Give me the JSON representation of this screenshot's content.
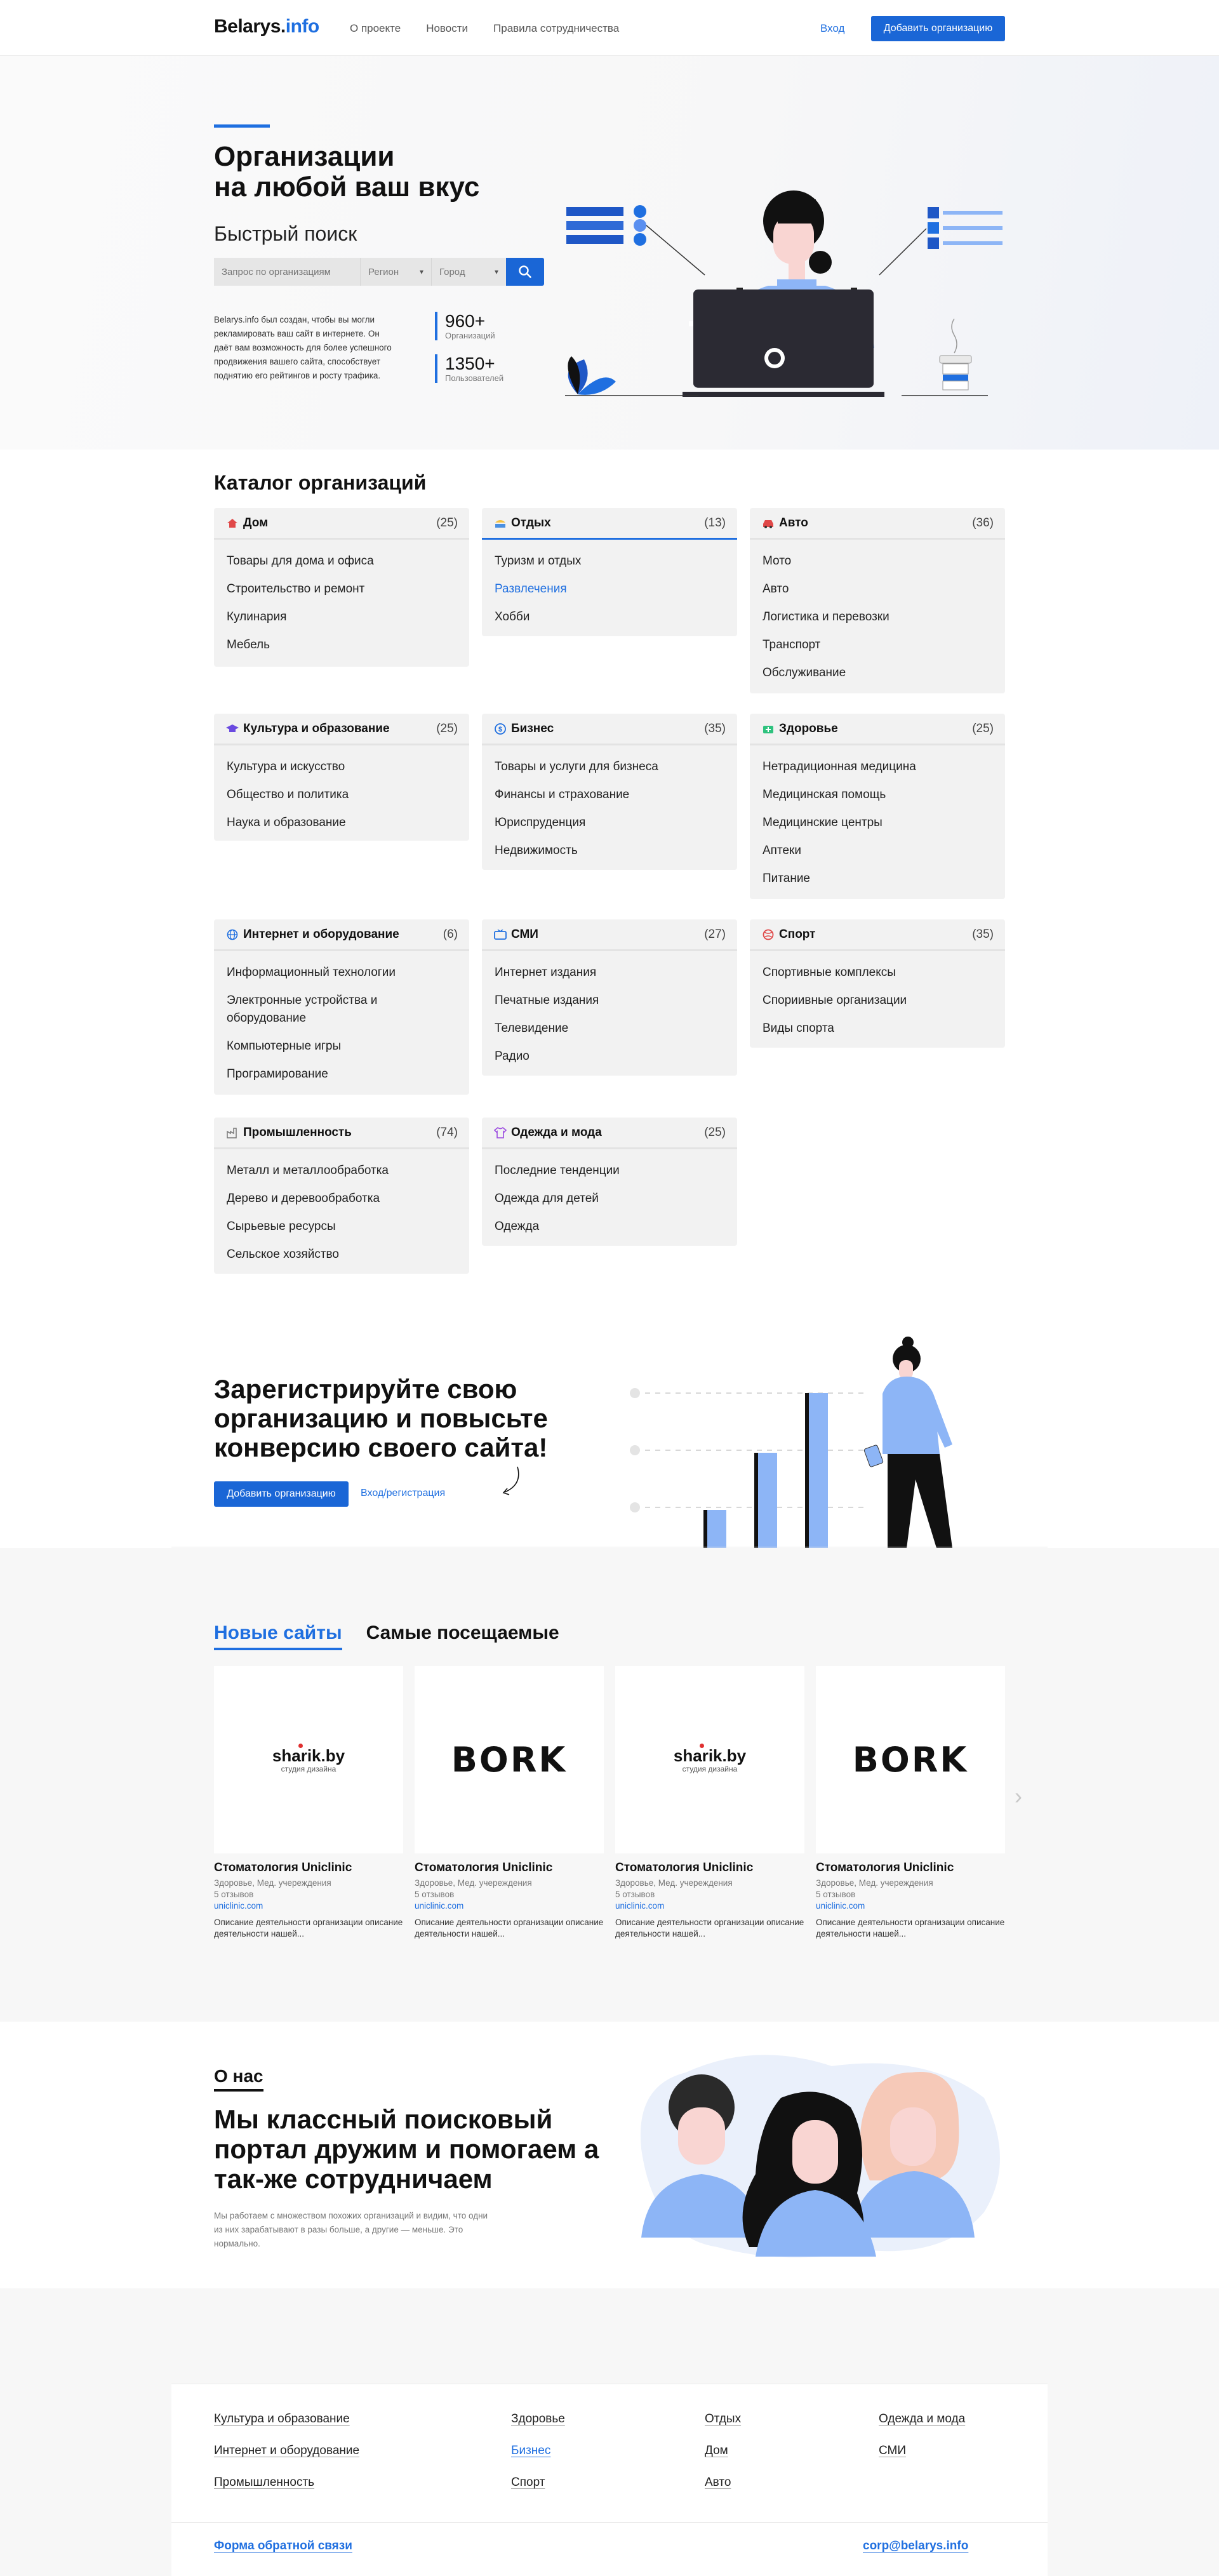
{
  "header": {
    "logo_main": "Belarys.",
    "logo_accent": "info",
    "nav": [
      "О проекте",
      "Новости",
      "Правила сотрудничества"
    ],
    "login": "Вход",
    "add_org": "Добавить организацию"
  },
  "hero": {
    "title_line1": "Организации",
    "title_line2": "на любой ваш вкус",
    "quick_search": "Быстрый поиск",
    "search_placeholder": "Запрос по организациям",
    "region": "Регион",
    "city": "Город",
    "description": "Belarys.info был создан, чтобы вы могли рекламировать ваш сайт в интернете. Он даёт вам возможность для более успешного продвижения вашего сайта, способствует поднятию его рейтингов и росту трафика.",
    "stats": [
      {
        "value": "960+",
        "label": "Организаций"
      },
      {
        "value": "1350+",
        "label": "Пользователей"
      }
    ]
  },
  "catalog": {
    "title": "Каталог организаций",
    "categories": [
      {
        "title": "Дом",
        "count": "(25)",
        "icon": "house-icon",
        "items": [
          "Товары для дома и офиса",
          "Строительство и ремонт",
          "Кулинария",
          "Мебель"
        ]
      },
      {
        "title": "Отдых",
        "count": "(13)",
        "icon": "beach-icon",
        "items": [
          "Туризм и отдых",
          "Развлечения",
          "Хобби"
        ]
      },
      {
        "title": "Авто",
        "count": "(36)",
        "icon": "car-icon",
        "items": [
          "Мото",
          "Авто",
          "Логистика и перевозки",
          "Транспорт",
          "Обслуживание"
        ]
      },
      {
        "title": "Культура и образование",
        "count": "(25)",
        "icon": "graduation-cap-icon",
        "items": [
          "Культура и искусство",
          "Общество и политика",
          "Наука и образование"
        ]
      },
      {
        "title": "Бизнес",
        "count": "(35)",
        "icon": "dollar-icon",
        "items": [
          "Товары и услуги для бизнеса",
          "Финансы и страхование",
          "Юриспруденция",
          "Недвижимость"
        ]
      },
      {
        "title": "Здоровье",
        "count": "(25)",
        "icon": "medical-kit-icon",
        "items": [
          "Нетрадиционная медицина",
          "Медицинская помощь",
          "Медицинские центры",
          "Аптеки",
          "Питание"
        ]
      },
      {
        "title": "Интернет и оборудование",
        "count": "(6)",
        "icon": "globe-icon",
        "items": [
          "Информационный технологии",
          "Электронные устройства и оборудование",
          "Компьютерные игры",
          "Програмирование"
        ]
      },
      {
        "title": "СМИ",
        "count": "(27)",
        "icon": "tv-icon",
        "items": [
          "Интернет издания",
          "Печатные издания",
          "Телевидение",
          "Радио"
        ]
      },
      {
        "title": "Спорт",
        "count": "(35)",
        "icon": "ball-icon",
        "items": [
          "Спортивные комплексы",
          "Спориивные организации",
          "Виды спорта"
        ]
      },
      {
        "title": "Промышленность",
        "count": "(74)",
        "icon": "factory-icon",
        "items": [
          "Металл и металлообработка",
          "Дерево и деревообработка",
          "Сырьевые ресурсы",
          "Сельское хозяйство"
        ]
      },
      {
        "title": "Одежда и мода",
        "count": "(25)",
        "icon": "tshirt-icon",
        "items": [
          "Последние тенденции",
          "Одежда для детей",
          "Одежда"
        ]
      }
    ]
  },
  "register": {
    "title": "Зарегистрируйте свою организацию и повысьте конверсию своего сайта!",
    "add_btn": "Добавить организацию",
    "login_link": "Вход/регистрация"
  },
  "sites": {
    "tab_new": "Новые сайты",
    "tab_popular": "Самые посещаемые",
    "cards": [
      {
        "logo": "sharik",
        "logo_text": "sharik.by",
        "logo_sub": "студия дизайна",
        "name": "Стоматология Uniclinic",
        "tags": "Здоровье, Мед. учереждения",
        "reviews": "5 отзывов",
        "url": "uniclinic.com",
        "text": "Описание деятельности организации описание деятельности нашей..."
      },
      {
        "logo": "bork",
        "logo_text": "BORK",
        "logo_sub": "",
        "name": "Стоматология Uniclinic",
        "tags": "Здоровье, Мед. учереждения",
        "reviews": "5 отзывов",
        "url": "uniclinic.com",
        "text": "Описание деятельности организации описание деятельности нашей..."
      },
      {
        "logo": "sharik",
        "logo_text": "sharik.by",
        "logo_sub": "студия дизайна",
        "name": "Стоматология Uniclinic",
        "tags": "Здоровье, Мед. учереждения",
        "reviews": "5 отзывов",
        "url": "uniclinic.com",
        "text": "Описание деятельности организации описание деятельности нашей..."
      },
      {
        "logo": "bork",
        "logo_text": "BORK",
        "logo_sub": "",
        "name": "Стоматология Uniclinic",
        "tags": "Здоровье, Мед. учереждения",
        "reviews": "5 отзывов",
        "url": "uniclinic.com",
        "text": "Описание деятельности организации описание деятельности нашей..."
      }
    ]
  },
  "about": {
    "label": "О нас",
    "title": "Мы классный поисковый портал дружим и помогаем а так-же сотрудничаем",
    "text": "Мы работаем с множеством похожих организаций и видим, что одни из них зарабатывают в разы больше, а другие — меньше. Это нормально."
  },
  "footer": {
    "links": [
      "Культура и образование",
      "Интернет и оборудование",
      "Промышленность",
      "Здоровье",
      "Бизнес",
      "Спорт",
      "Отдых",
      "Дом",
      "Авто",
      "Одежда и мода",
      "СМИ"
    ],
    "feedback": "Форма обратной связи",
    "email": "corp@belarys.info"
  }
}
